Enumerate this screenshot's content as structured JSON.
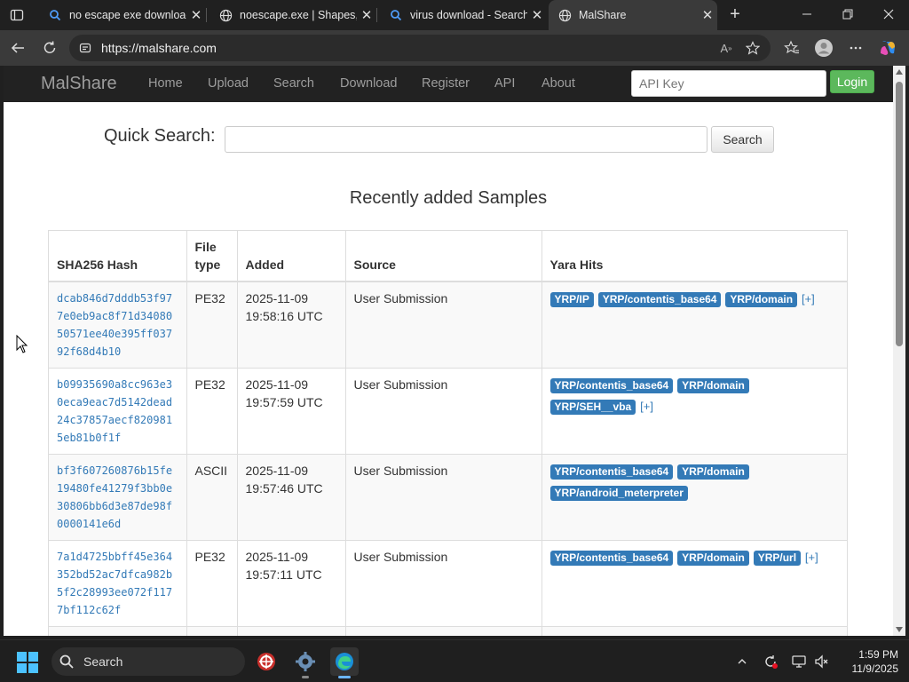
{
  "browser": {
    "tabs": [
      {
        "label": "no escape exe download",
        "icon": "search-icon",
        "close": "✕"
      },
      {
        "label": "noescape.exe | Shapes, I",
        "icon": "globe-icon",
        "close": "✕"
      },
      {
        "label": "virus download - Search",
        "icon": "search-icon",
        "close": "✕"
      },
      {
        "label": "MalShare",
        "icon": "globe-icon",
        "close": "✕",
        "active": true
      }
    ],
    "url": "https://malshare.com"
  },
  "site": {
    "brand": "MalShare",
    "nav": [
      "Home",
      "Upload",
      "Search",
      "Download",
      "Register",
      "API",
      "About"
    ],
    "api_key_placeholder": "API Key",
    "login_label": "Login"
  },
  "quick_search": {
    "label": "Quick Search:",
    "value": "",
    "button": "Search"
  },
  "samples": {
    "heading": "Recently added Samples",
    "columns": [
      "SHA256 Hash",
      "File type",
      "Added",
      "Source",
      "Yara Hits"
    ],
    "rows": [
      {
        "hash": "dcab846d7dddb53f977e0eb9ac8f71d3408050571ee40e395ff03792f68d4b10",
        "type": "PE32",
        "added": "2025-11-09 19:58:16 UTC",
        "source": "User Submission",
        "tags": [
          "YRP/IP",
          "YRP/contentis_base64",
          "YRP/domain"
        ],
        "more": "[+]"
      },
      {
        "hash": "b09935690a8cc963e30eca9eac7d5142dead24c37857aecf8209815eb81b0f1f",
        "type": "PE32",
        "added": "2025-11-09 19:57:59 UTC",
        "source": "User Submission",
        "tags": [
          "YRP/contentis_base64",
          "YRP/domain",
          "YRP/SEH__vba"
        ],
        "more": "[+]"
      },
      {
        "hash": "bf3f607260876b15fe19480fe41279f3bb0e30806bb6d3e87de98f0000141e6d",
        "type": "ASCII",
        "added": "2025-11-09 19:57:46 UTC",
        "source": "User Submission",
        "tags": [
          "YRP/contentis_base64",
          "YRP/domain",
          "YRP/android_meterpreter"
        ],
        "more": ""
      },
      {
        "hash": "7a1d4725bbff45e364352bd52ac7dfca982b5f2c28993ee072f1177bf112c62f",
        "type": "PE32",
        "added": "2025-11-09 19:57:11 UTC",
        "source": "User Submission",
        "tags": [
          "YRP/contentis_base64",
          "YRP/domain",
          "YRP/url"
        ],
        "more": "[+]"
      }
    ]
  },
  "taskbar": {
    "search_label": "Search",
    "time": "1:59 PM",
    "date": "11/9/2025"
  },
  "colors": {
    "navbar": "#222222",
    "tag": "#337ab7",
    "login": "#5cb85c",
    "link": "#337ab7"
  }
}
